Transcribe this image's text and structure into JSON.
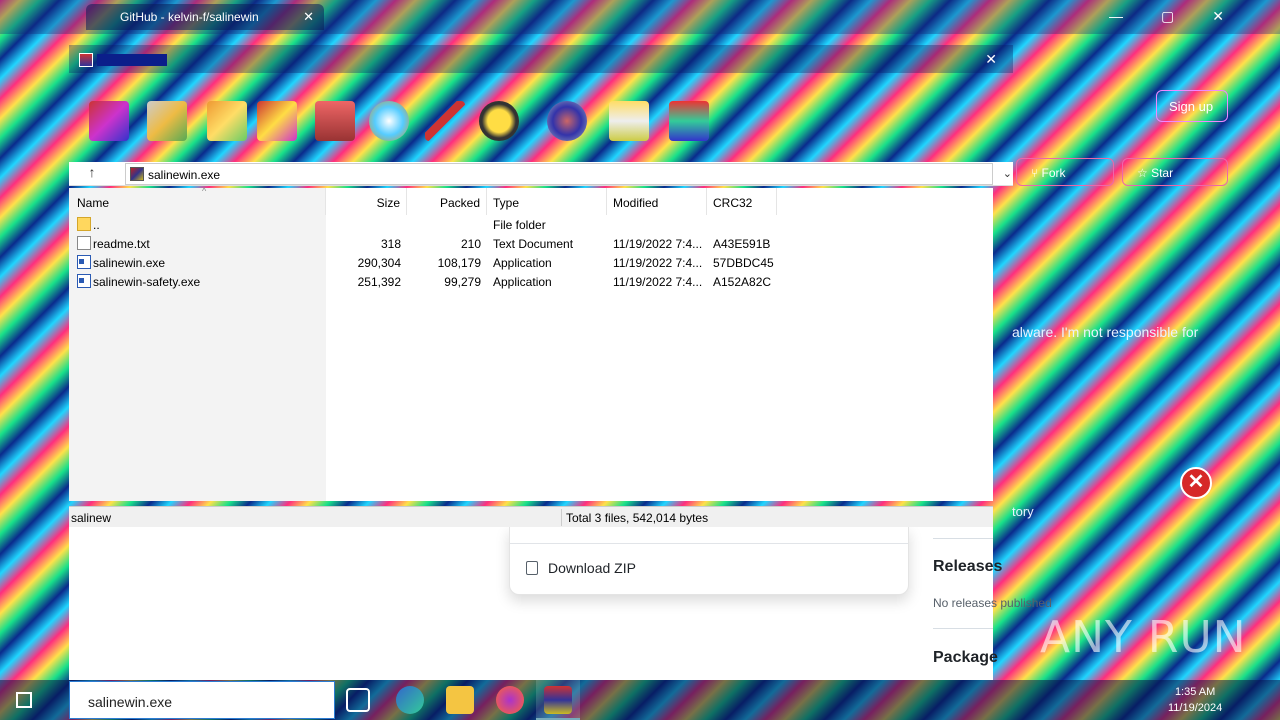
{
  "browser": {
    "tab_title": "GitHub - kelvin-f/salinewin",
    "signup": "Sign up",
    "fork_label": "Fork",
    "star_label": "Star",
    "repo_desc": "alware. I'm not responsible for",
    "history": "tory"
  },
  "winrar": {
    "address": "salinewin.exe",
    "columns": [
      "Name",
      "Size",
      "Packed",
      "Type",
      "Modified",
      "CRC32"
    ],
    "files": [
      {
        "name": "..",
        "size": "",
        "packed": "",
        "type": "File folder",
        "modified": "",
        "crc": "",
        "icon": "folder-icon"
      },
      {
        "name": "readme.txt",
        "size": "318",
        "packed": "210",
        "type": "Text Document",
        "modified": "11/19/2022 7:4...",
        "crc": "A43E591B",
        "icon": "text-file-icon"
      },
      {
        "name": "salinewin.exe",
        "size": "290,304",
        "packed": "108,179",
        "type": "Application",
        "modified": "11/19/2022 7:4...",
        "crc": "57DBDC45",
        "icon": "exe-file-icon"
      },
      {
        "name": "salinewin-safety.exe",
        "size": "251,392",
        "packed": "99,279",
        "type": "Application",
        "modified": "11/19/2022 7:4...",
        "crc": "A152A82C",
        "icon": "exe-file-icon"
      }
    ],
    "status_left": "salinew",
    "status_right": "Total 3 files, 542,014 bytes"
  },
  "github": {
    "download_zip": "Download ZIP",
    "releases_title": "Releases",
    "releases_none": "No releases published",
    "packages_title": "Package"
  },
  "taskbar": {
    "search_value": "salinewin.exe",
    "time": "1:35 AM",
    "date": "11/19/2024"
  },
  "watermark": "ANY RUN",
  "colors": {
    "accent": "#2b7cd3",
    "error": "#d62828"
  }
}
